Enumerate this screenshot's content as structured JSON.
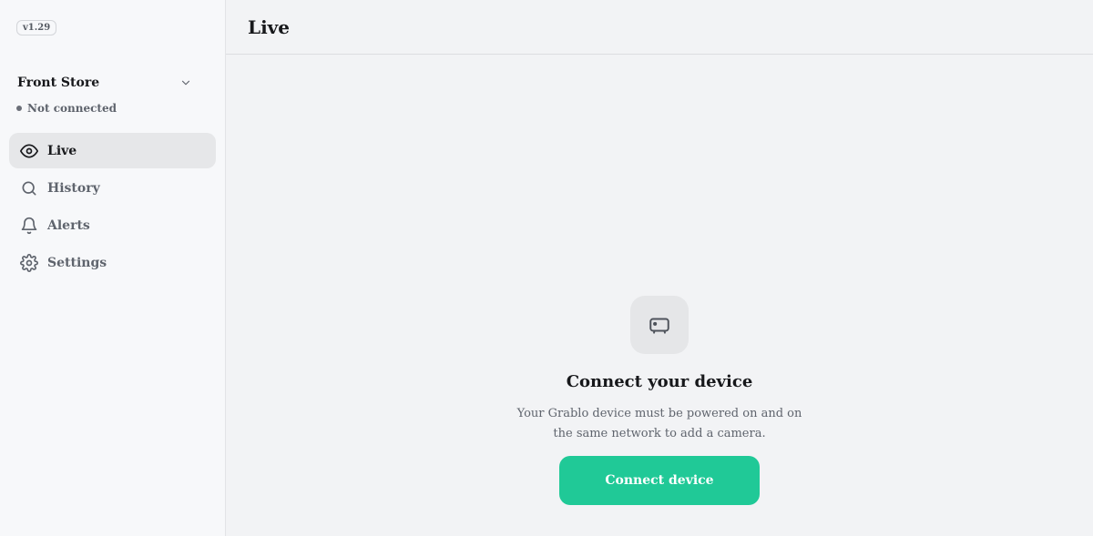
{
  "app": {
    "version": "v1.29"
  },
  "sidebar": {
    "store_name": "Front Store",
    "status": "Not connected",
    "items": [
      {
        "label": "Live",
        "icon": "eye-icon",
        "active": true
      },
      {
        "label": "History",
        "icon": "search-icon",
        "active": false
      },
      {
        "label": "Alerts",
        "icon": "bell-icon",
        "active": false
      },
      {
        "label": "Settings",
        "icon": "gear-icon",
        "active": false
      }
    ]
  },
  "header": {
    "title": "Live"
  },
  "main": {
    "empty_state": {
      "icon": "device-icon",
      "title": "Connect your device",
      "description": "Your Grablo device must be powered on and on the same network to add a camera.",
      "button_label": "Connect device"
    }
  },
  "colors": {
    "accent": "#20c997",
    "sidebar_bg": "#f7f8fa",
    "main_bg": "#f2f3f5",
    "active_item_bg": "#e6e7e9"
  }
}
